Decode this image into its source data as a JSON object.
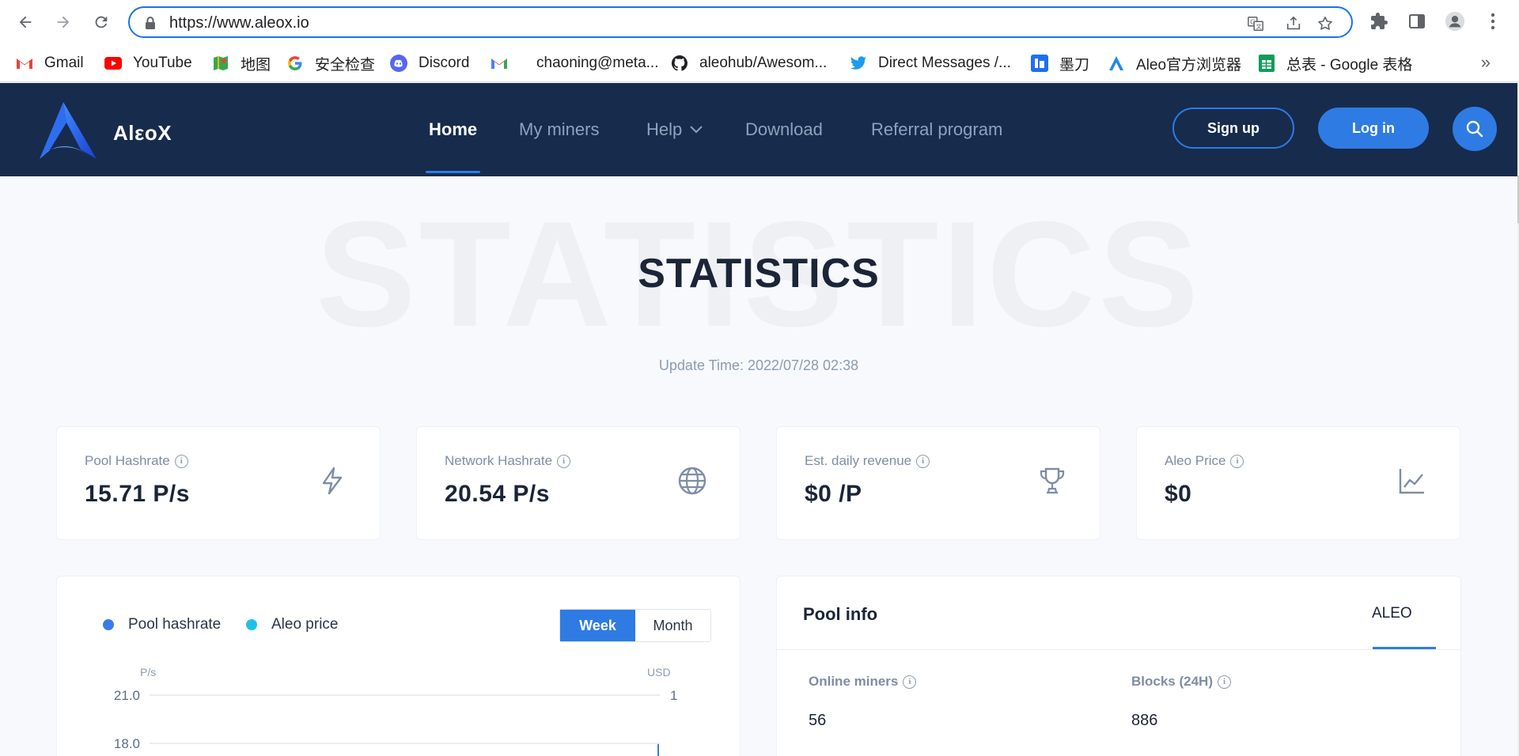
{
  "browser": {
    "url": "https://www.aleox.io",
    "bookmarks": [
      {
        "label": "Gmail",
        "icon": "gmail-icon"
      },
      {
        "label": "YouTube",
        "icon": "youtube-icon"
      },
      {
        "label": "地图",
        "icon": "maps-icon"
      },
      {
        "label": "安全检查",
        "icon": "google-icon"
      },
      {
        "label": "Discord",
        "icon": "discord-icon"
      },
      {
        "label": "chaoning@meta...",
        "icon": "gmail-icon"
      },
      {
        "label": "aleohub/Awesom...",
        "icon": "github-icon"
      },
      {
        "label": "Direct Messages /...",
        "icon": "twitter-icon"
      },
      {
        "label": "墨刀",
        "icon": "modao-icon"
      },
      {
        "label": "Aleo官方浏览器",
        "icon": "aleo-icon"
      },
      {
        "label": "总表 - Google 表格",
        "icon": "sheets-icon"
      }
    ],
    "more": "»"
  },
  "header": {
    "logo_text": "AlεoX",
    "menu": [
      "Home",
      "My miners",
      "Help",
      "Download",
      "Referral program"
    ],
    "signup": "Sign up",
    "login": "Log in"
  },
  "main": {
    "bg_title": "STATISTICS",
    "title": "STATISTICS",
    "update_time": "Update Time: 2022/07/28 02:38",
    "stats": [
      {
        "label": "Pool Hashrate",
        "value": "15.71 P/s",
        "icon": "lightning-icon"
      },
      {
        "label": "Network Hashrate",
        "value": "20.54 P/s",
        "icon": "globe-icon"
      },
      {
        "label": "Est. daily revenue",
        "value": "$0 /P",
        "icon": "trophy-icon"
      },
      {
        "label": "Aleo Price",
        "value": "$0",
        "icon": "line-chart-icon"
      }
    ]
  },
  "chart": {
    "legend": [
      "Pool hashrate",
      "Aleo price"
    ],
    "toggle": [
      "Week",
      "Month"
    ],
    "left_unit": "P/s",
    "right_unit": "USD",
    "colors": {
      "hashrate": "#3b7be6",
      "price": "#1fc2e6"
    }
  },
  "chart_data": {
    "type": "line",
    "yTicksLeft": [
      "21.0",
      "18.0"
    ],
    "yTicksRight": [
      "1"
    ],
    "ylabel_left": "P/s",
    "ylabel_right": "USD"
  },
  "pool": {
    "title": "Pool info",
    "tab": "ALEO",
    "fields": [
      {
        "label": "Online miners",
        "value": "56"
      },
      {
        "label": "Blocks (24H)",
        "value": "886"
      }
    ]
  }
}
